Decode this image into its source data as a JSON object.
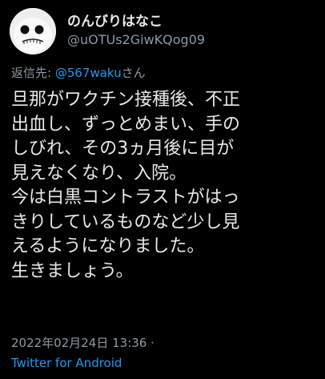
{
  "user": {
    "display_name": "のんびりはなこ",
    "handle": "@uOTUs2GiwKQog09",
    "avatar_icon": "ghost-face-avatar"
  },
  "reply": {
    "prefix": "返信先: ",
    "mention": "@567waku",
    "suffix": "さん"
  },
  "tweet": {
    "lines": [
      "旦那がワクチン接種後、不正",
      "出血し、ずっとめまい、手の",
      "しびれ、その3ヵ月後に目が",
      "見えなくなり、入院。",
      "今は白黒コントラストがはっ",
      "きりしているものなど少し見",
      "えるようになりました。",
      "生きましょう。"
    ]
  },
  "meta": {
    "timestamp": "2022年02月24日 13:36 ·",
    "source": "Twitter for Android"
  },
  "colors": {
    "background": "#000000",
    "text": "#e7e9ea",
    "secondary": "#8b98a5",
    "link": "#1d9bf0"
  }
}
